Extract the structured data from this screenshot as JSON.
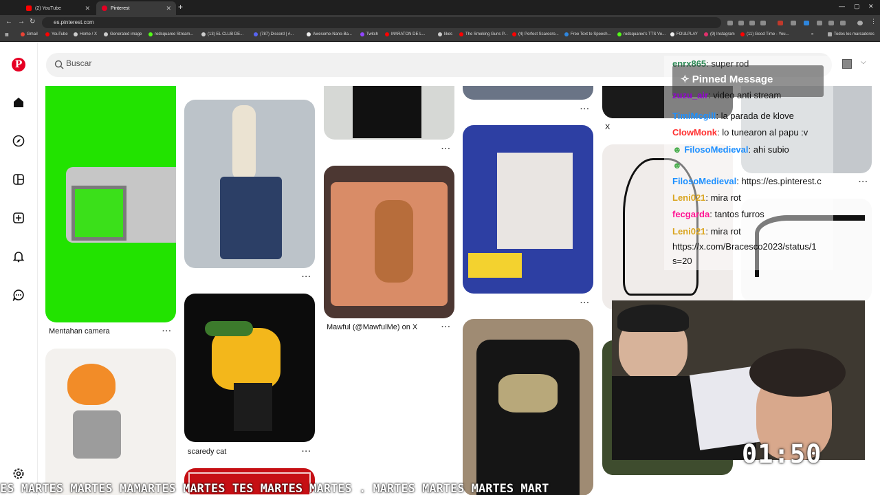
{
  "browser": {
    "tabs": [
      {
        "title": "(2) YouTube",
        "color": "#ff0000"
      },
      {
        "title": "Pinterest",
        "color": "#e60023"
      }
    ],
    "url": "es.pinterest.com",
    "bookmarks": [
      "Gmail",
      "YouTube",
      "Home / X",
      "Generated image",
      "rodsquaree Stream...",
      "(13) EL CLUB DE...",
      "(787) Discord | #...",
      "Awesome-Nano-Ba...",
      "Twitch",
      "MARATON DE L...",
      "likes",
      "The Smoking Guns P...",
      "(4) Perfect Scarecro...",
      "Free Text to Speech...",
      "rodsquaree's TTS Vo...",
      "FOULPLAY",
      "(9) Instagram",
      "(11) Good Time - You..."
    ],
    "bookmarks_folder": "Todos los marcadores"
  },
  "pinterest": {
    "search_placeholder": "Buscar",
    "brand_color": "#e60023",
    "pins": [
      {
        "label": "Mentahan camera"
      },
      {
        "label": "scaredy cat"
      },
      {
        "label": "Mawful (@MawfulMe) on X"
      },
      {
        "label": "X"
      }
    ],
    "more_label": "···"
  },
  "stream": {
    "chat": [
      {
        "user": "enrx865",
        "text": "super rod",
        "color": "#2e8b57"
      },
      {
        "user": "zuzu_air",
        "text": "video anti stream",
        "color": "#9400d3"
      },
      {
        "user": "TimiMcgill",
        "text": "la parada de klove",
        "color": "#1e90ff"
      },
      {
        "user": "ClowMonk",
        "text": "lo tunearon al papu :v",
        "color": "#ff3030"
      },
      {
        "user": "FilosoMedieval",
        "text": "ahi subio",
        "color": "#1e90ff"
      },
      {
        "user": "FilosoMedieval",
        "text": "https://es.pinterest.c",
        "color": "#1e90ff"
      },
      {
        "user": "Leni021",
        "text": "mira rot",
        "color": "#daa520"
      },
      {
        "user": "fecgarda",
        "text": "tantos furros",
        "color": "#ff1493"
      },
      {
        "user": "Leni021",
        "text": "mira rot",
        "color": "#daa520"
      }
    ],
    "chat_link": "https://x.com/Bracesco2023/status/1",
    "chat_link_cont": "s=20",
    "pinned_label": "Pinned Message",
    "timer": "01:50",
    "ticker": "ES MARTES MARTES MAMARTES MARTES TES MARTES MARTES . MARTES MARTES MARTES MART"
  }
}
